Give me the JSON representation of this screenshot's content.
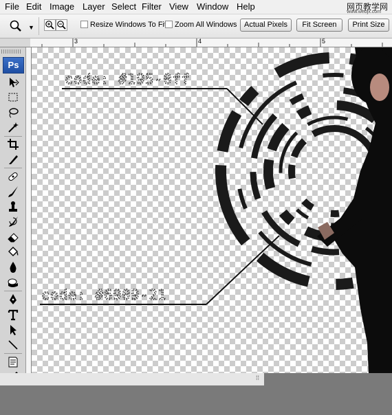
{
  "menubar": {
    "items": [
      "File",
      "Edit",
      "Image",
      "Layer",
      "Select",
      "Filter",
      "View",
      "Window",
      "Help"
    ],
    "watermark": "网页教学网",
    "watermark_sub": "www.webjx.com"
  },
  "options": {
    "resize_windows_label": "Resize Windows To Fit",
    "zoom_all_label": "Zoom All Windows",
    "actual_pixels_label": "Actual Pixels",
    "fit_screen_label": "Fit Screen",
    "print_size_label": "Print Size"
  },
  "ruler": {
    "ticks": [
      "3",
      "4",
      "5"
    ]
  },
  "toolbox": {
    "logo": "Ps"
  },
  "canvas": {
    "annotation_top": "code: #195-0ff",
    "annotation_bottom": "code: #6909-21"
  },
  "colors": {
    "accent": "#1f4fa3",
    "rings": "#1a1a1a",
    "checker": "#cccccc"
  }
}
